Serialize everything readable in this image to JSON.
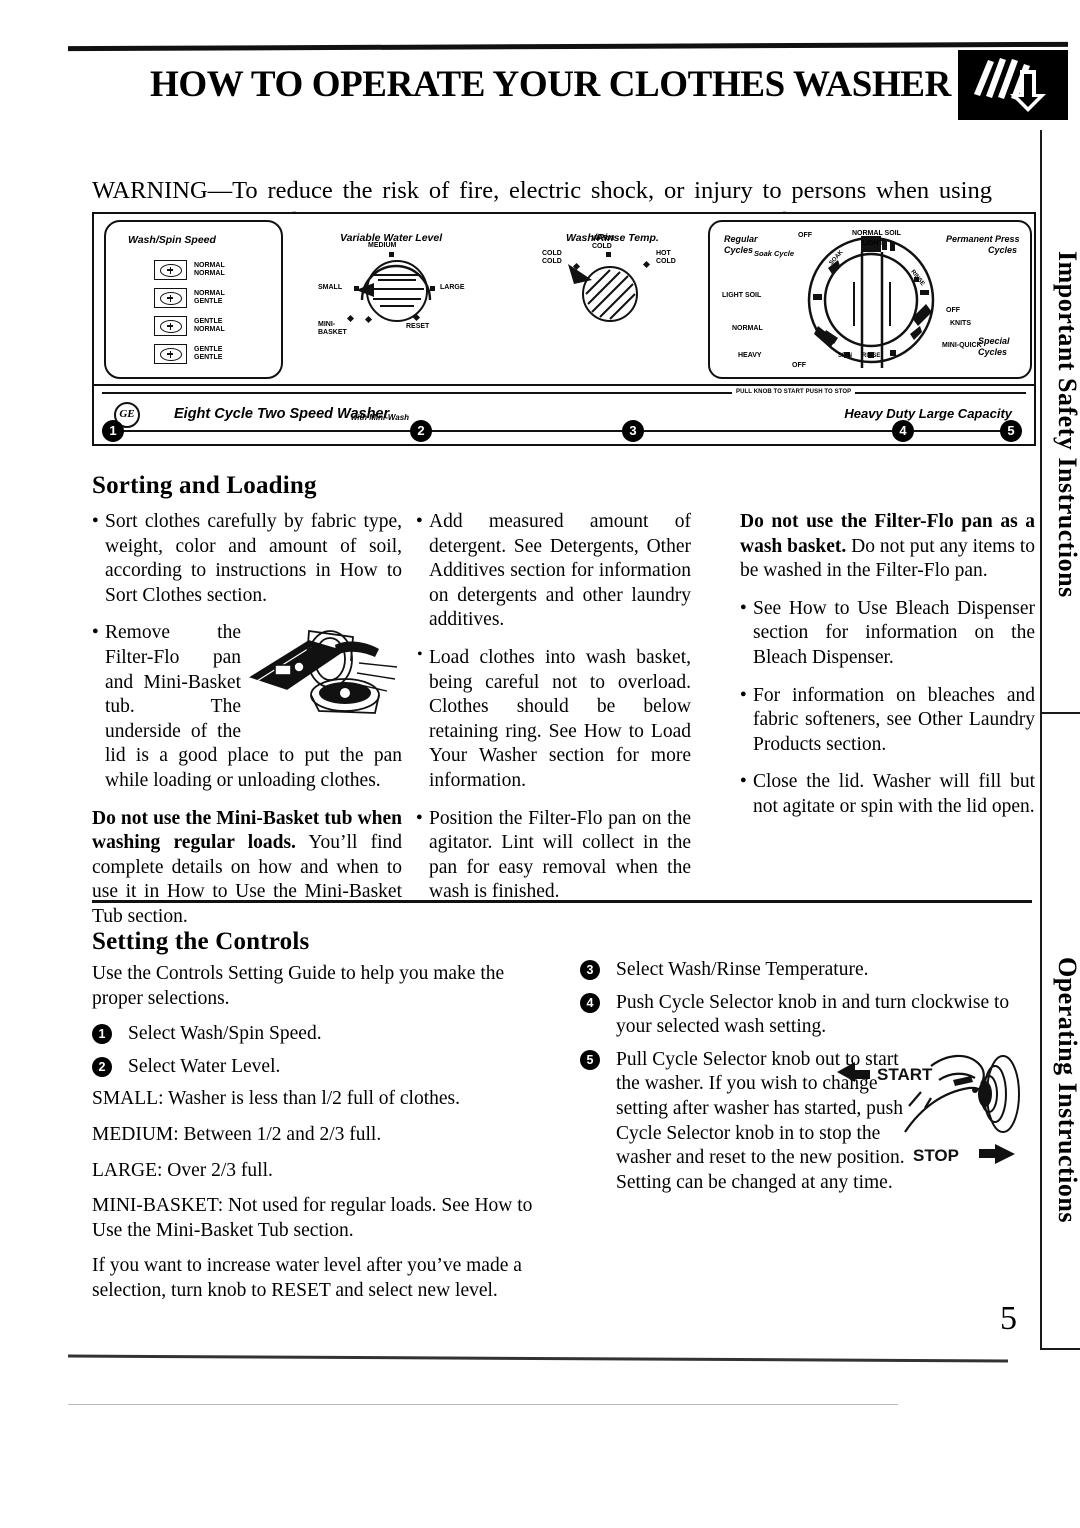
{
  "document": {
    "title": "HOW TO OPERATE YOUR CLOTHES WASHER",
    "page_number": "5",
    "warning": "WARNING—To reduce the risk of fire, electric shock, or injury to persons when using your appliance, read the IMPORTANT SAFETY INSTRUCTIONS before operating this appliance."
  },
  "side_tabs": {
    "safety": "Important Safety Instructions",
    "operating": "Operating Instructions"
  },
  "control_panel": {
    "wash_spin_speed": {
      "heading": "Wash/Spin  Speed",
      "buttons": [
        {
          "line1": "NORMAL",
          "line2": "NORMAL"
        },
        {
          "line1": "NORMAL",
          "line2": "GENTLE"
        },
        {
          "line1": "GENTLE",
          "line2": "NORMAL"
        },
        {
          "line1": "GENTLE",
          "line2": "GENTLE"
        }
      ]
    },
    "water_level": {
      "heading": "Variable Water Level",
      "labels": {
        "medium": "MEDIUM",
        "small": "SMALL",
        "large": "LARGE",
        "mini_basket_1": "MINI-",
        "mini_basket_2": "BASKET",
        "reset": "RESET"
      }
    },
    "temperature": {
      "heading": "Wash/Rinse  Temp.",
      "labels": {
        "warm_cold_1": "WARM",
        "warm_cold_2": "COLD",
        "cold_cold_1": "COLD",
        "cold_cold_2": "COLD",
        "hot_cold_1": "HOT",
        "hot_cold_2": "COLD"
      }
    },
    "cycles": {
      "regular_1": "Regular",
      "regular_2": "Cycles",
      "perm_press_1": "Permanent Press",
      "perm_press_2": "Cycles",
      "special_1": "Special",
      "special_2": "Cycles",
      "soak_cycle": "Soak Cycle",
      "light_soil": "LIGHT SOIL",
      "normal": "NORMAL",
      "heavy": "HEAVY",
      "off_left": "OFF",
      "off_top": "OFF",
      "off_right": "OFF",
      "normal_soil": "NORMAL SOIL",
      "light": "LIGHT",
      "knits": "KNITS",
      "mini_quick": "MINI-QUICK",
      "spin": "SPIN",
      "rinse": "RINSE",
      "soak_dial": "SOAK",
      "rinse_dial": "RINSE"
    },
    "pull_knob_text": "PULL KNOB TO START PUSH TO STOP",
    "brand": "GE",
    "model_name": "Eight Cycle Two Speed Washer",
    "model_sub": "with Mini-Wash",
    "capacity": "Heavy Duty Large Capacity",
    "callout_numbers": [
      "1",
      "2",
      "3",
      "4",
      "5"
    ]
  },
  "sorting": {
    "heading": "Sorting and Loading",
    "col1": {
      "b1": "Sort clothes carefully by fabric type, weight, color and amount of soil, according to instructions in How to Sort Clothes section.",
      "b2": "Remove the Filter-Flo pan and Mini-Basket tub. The underside of the lid is a good place to put the pan while loading or unloading clothes.",
      "note_bold": "Do not use the Mini-Basket tub when washing regular loads.",
      "note_rest": " You’ll find complete details on how and when to use it in How to Use the Mini-Basket Tub section."
    },
    "col2": {
      "b1": "Add measured amount of detergent. See Detergents, Other Additives section for information on detergents and other laundry additives.",
      "b2": "Load clothes into wash basket, being careful not to overload. Clothes should be below retaining ring. See How to Load Your Washer section for more information.",
      "b3": "Position the Filter-Flo pan on the agitator. Lint will collect in the pan for easy removal when the wash is finished."
    },
    "col3": {
      "note_bold": "Do not use the Filter-Flo pan as a wash basket.",
      "note_rest": " Do not put any items to be washed in the Filter-Flo pan.",
      "b1": "See How to Use Bleach Dispenser section for information on the Bleach Dispenser.",
      "b2": "For information on bleaches and fabric softeners, see Other Laundry Products section.",
      "b3": "Close the lid. Washer will fill but not agitate or spin with the lid open."
    }
  },
  "settings": {
    "heading": "Setting the Controls",
    "intro": "Use the Controls Setting Guide to help you make the proper  selections.",
    "step1": "Select Wash/Spin Speed.",
    "step2": "Select Water Level.",
    "levels": {
      "small": "SMALL: Washer is less than l/2 full of clothes.",
      "medium": "MEDIUM: Between 1/2 and 2/3 full.",
      "large": "LARGE: Over 2/3 full.",
      "mini_basket": "MINI-BASKET: Not used for regular loads. See How to Use the Mini-Basket Tub section."
    },
    "reset_note": "If you want to increase water level after you’ve made a selection, turn knob to RESET and select new level.",
    "step3": "Select  Wash/Rinse  Temperature.",
    "step4": "Push Cycle Selector knob in and  turn  clockwise to your  selected  wash  setting.",
    "step5": "Pull Cycle Selector knob out to start the washer. If you wish to change setting after washer has started, push Cycle Selector knob in to stop the washer and reset to the new position. Setting can be changed at any time.",
    "knob_art": {
      "start": "START",
      "stop": "STOP"
    }
  }
}
